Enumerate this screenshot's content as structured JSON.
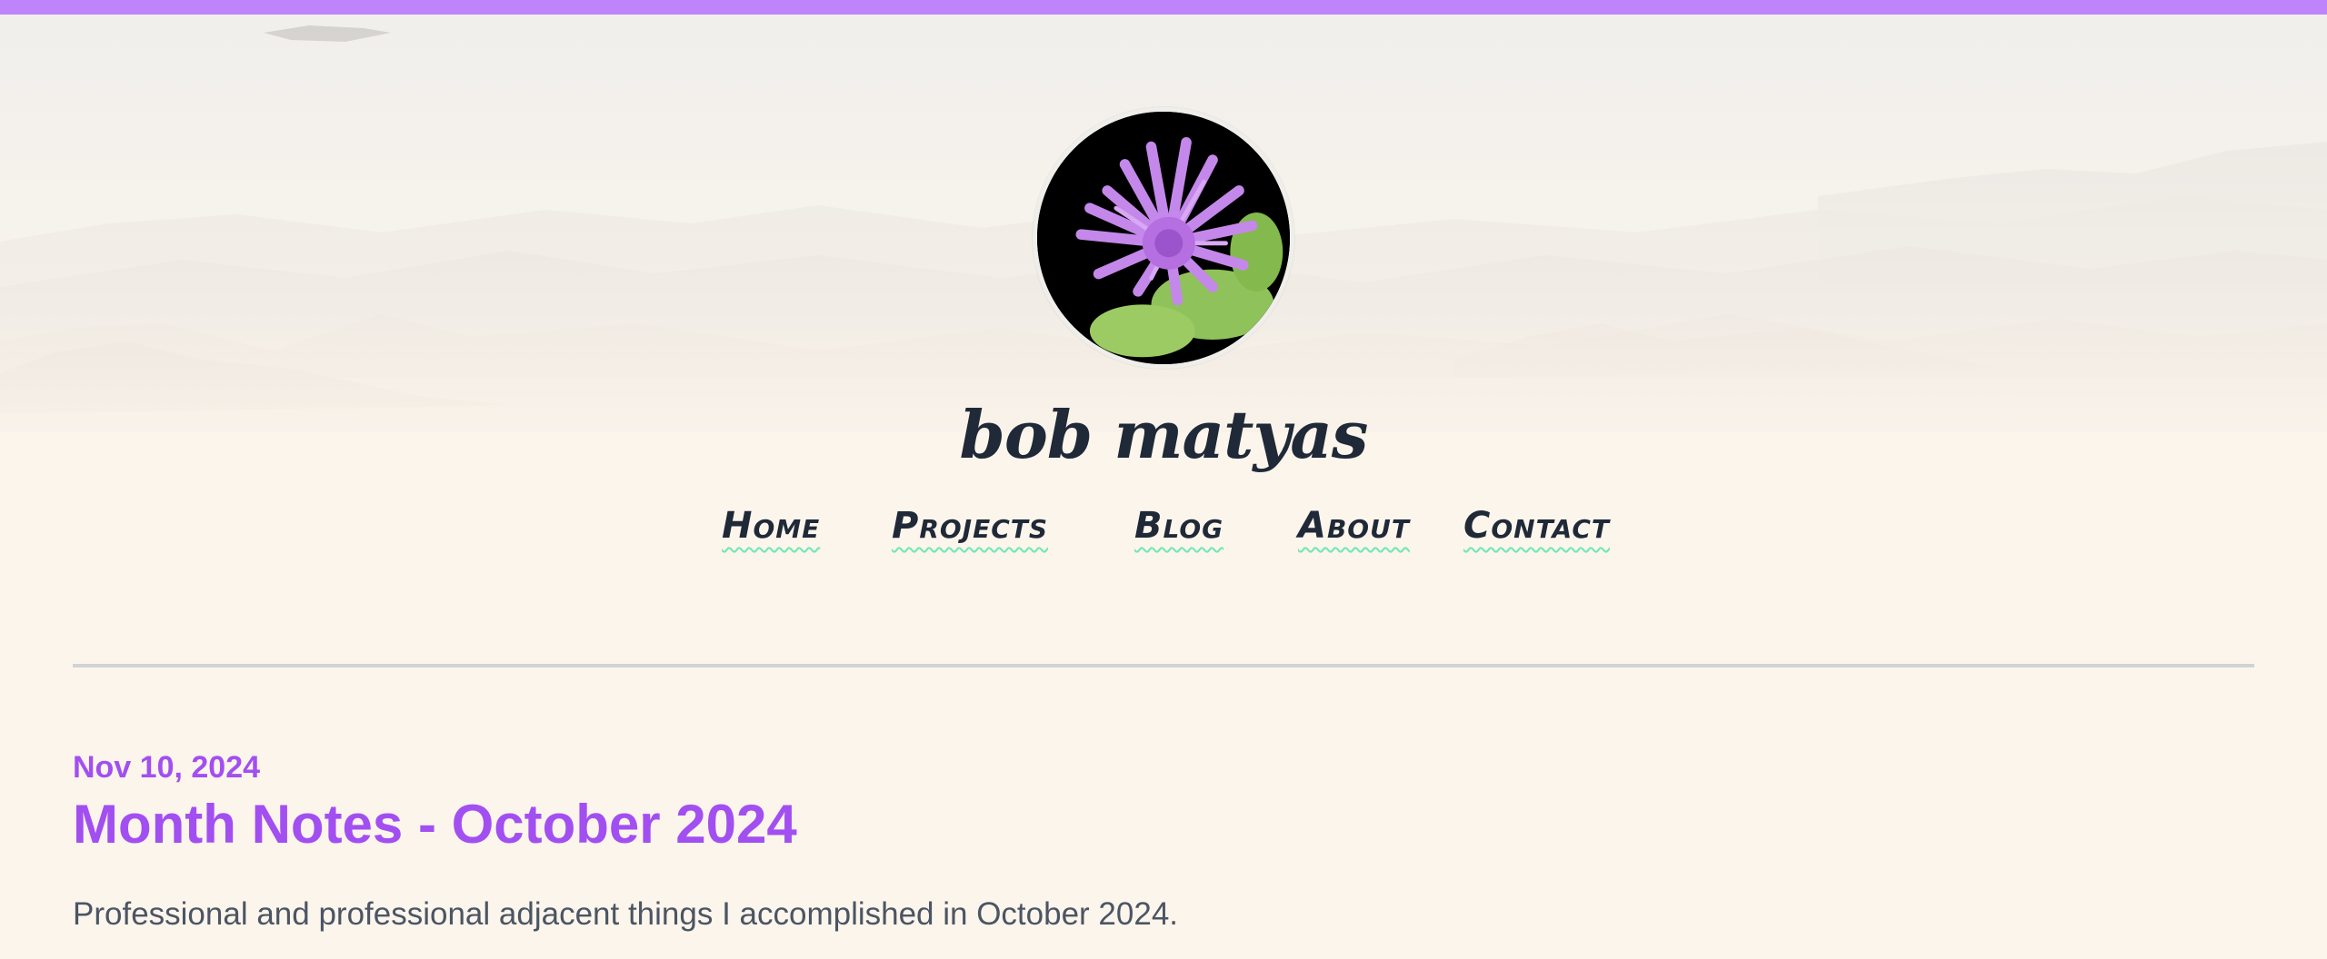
{
  "site": {
    "title": "bob matyas"
  },
  "nav": {
    "items": [
      {
        "label": "Home"
      },
      {
        "label": "Projects"
      },
      {
        "label": "Blog"
      },
      {
        "label": "About"
      },
      {
        "label": "Contact"
      }
    ]
  },
  "post": {
    "date": "Nov 10, 2024",
    "title": "Month Notes - October 2024",
    "summary": "Professional and professional adjacent things I accomplished in October 2024."
  },
  "colors": {
    "accent_bar": "#bf83fb",
    "accent_text": "#a24ff1",
    "nav_underline": "#6ee7b7",
    "title_text": "#1f2937",
    "body_text": "#4b5563",
    "background": "#fcf5ec"
  }
}
